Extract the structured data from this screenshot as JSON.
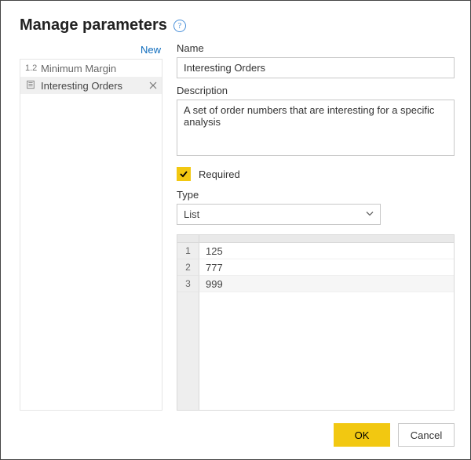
{
  "title": "Manage parameters",
  "new_link": "New",
  "sidebar": {
    "items": [
      {
        "icon": "1.2",
        "label": "Minimum Margin",
        "selected": false
      },
      {
        "icon": "list",
        "label": "Interesting Orders",
        "selected": true
      }
    ]
  },
  "form": {
    "name_label": "Name",
    "name_value": "Interesting Orders",
    "description_label": "Description",
    "description_value": "A set of order numbers that are interesting for a specific analysis",
    "required_label": "Required",
    "required_checked": true,
    "type_label": "Type",
    "type_value": "List",
    "list_values": [
      "125",
      "777",
      "999"
    ]
  },
  "buttons": {
    "ok": "OK",
    "cancel": "Cancel"
  }
}
